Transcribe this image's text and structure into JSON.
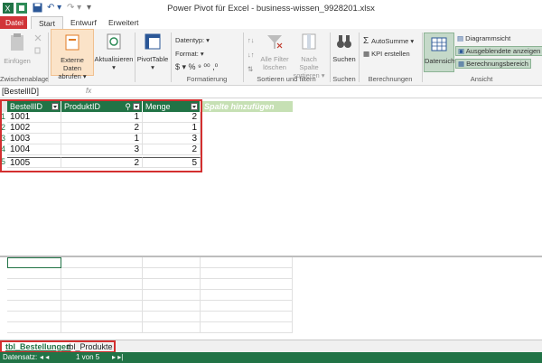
{
  "window": {
    "title": "Power Pivot für Excel - business-wissen_9928201.xlsx"
  },
  "tabs": [
    "Datei",
    "Start",
    "Entwurf",
    "Erweitert"
  ],
  "ribbon": {
    "groups": {
      "zwischenablage": "Zwischenablage",
      "formatierung": "Formatierung",
      "sortieren": "Sortieren und filtern",
      "suchen": "Suchen",
      "berechnungen": "Berechnungen",
      "ansicht": "Ansicht"
    },
    "einfuegen": "Einfügen",
    "externe_daten": [
      "Externe Daten",
      "abrufen ▾"
    ],
    "aktualisieren": [
      "Aktualisieren",
      "▾"
    ],
    "pivottable": [
      "PivotTable",
      "▾"
    ],
    "datentyp": "Datentyp: ▾",
    "format": "Format: ▾",
    "format_symbols": "$ ▾  %  ⁹  ⁰⁰  ,⁰",
    "alle_filter": [
      "Alle Filter",
      "löschen"
    ],
    "nach_spalte": [
      "Nach Spalte",
      "sortieren ▾"
    ],
    "suchen_btn": "Suchen",
    "autosumme": "AutoSumme ▾",
    "kpi": "KPI erstellen",
    "datensicht": "Datensicht",
    "diagrammsicht": "Diagrammsicht",
    "ausgeblendete": "Ausgeblendete anzeigen",
    "berechnungsbereich": "Berechnungsbereich"
  },
  "formula_bar": {
    "name_box": "[BestellID]",
    "fx": "fx"
  },
  "table": {
    "columns": [
      "BestellID",
      "ProduktID",
      "Menge"
    ],
    "add_column": "Spalte hinzufügen",
    "row_numbers": [
      "1",
      "2",
      "3",
      "4",
      "5"
    ],
    "rows": [
      [
        "1001",
        "1",
        "2"
      ],
      [
        "1002",
        "2",
        "1"
      ],
      [
        "1003",
        "1",
        "3"
      ],
      [
        "1004",
        "3",
        "2"
      ],
      [
        "1005",
        "2",
        "5"
      ]
    ]
  },
  "sheets": [
    "tbl_Bestellungen",
    "tbl_Produkte"
  ],
  "status": {
    "label": "Datensatz:",
    "nav_left": "◂  ◂",
    "position": "1 von 5",
    "nav_right": "▸  ▸|"
  },
  "colors": {
    "accent": "#217346",
    "file_tab": "#d13438",
    "highlight": "#d32f2f"
  }
}
